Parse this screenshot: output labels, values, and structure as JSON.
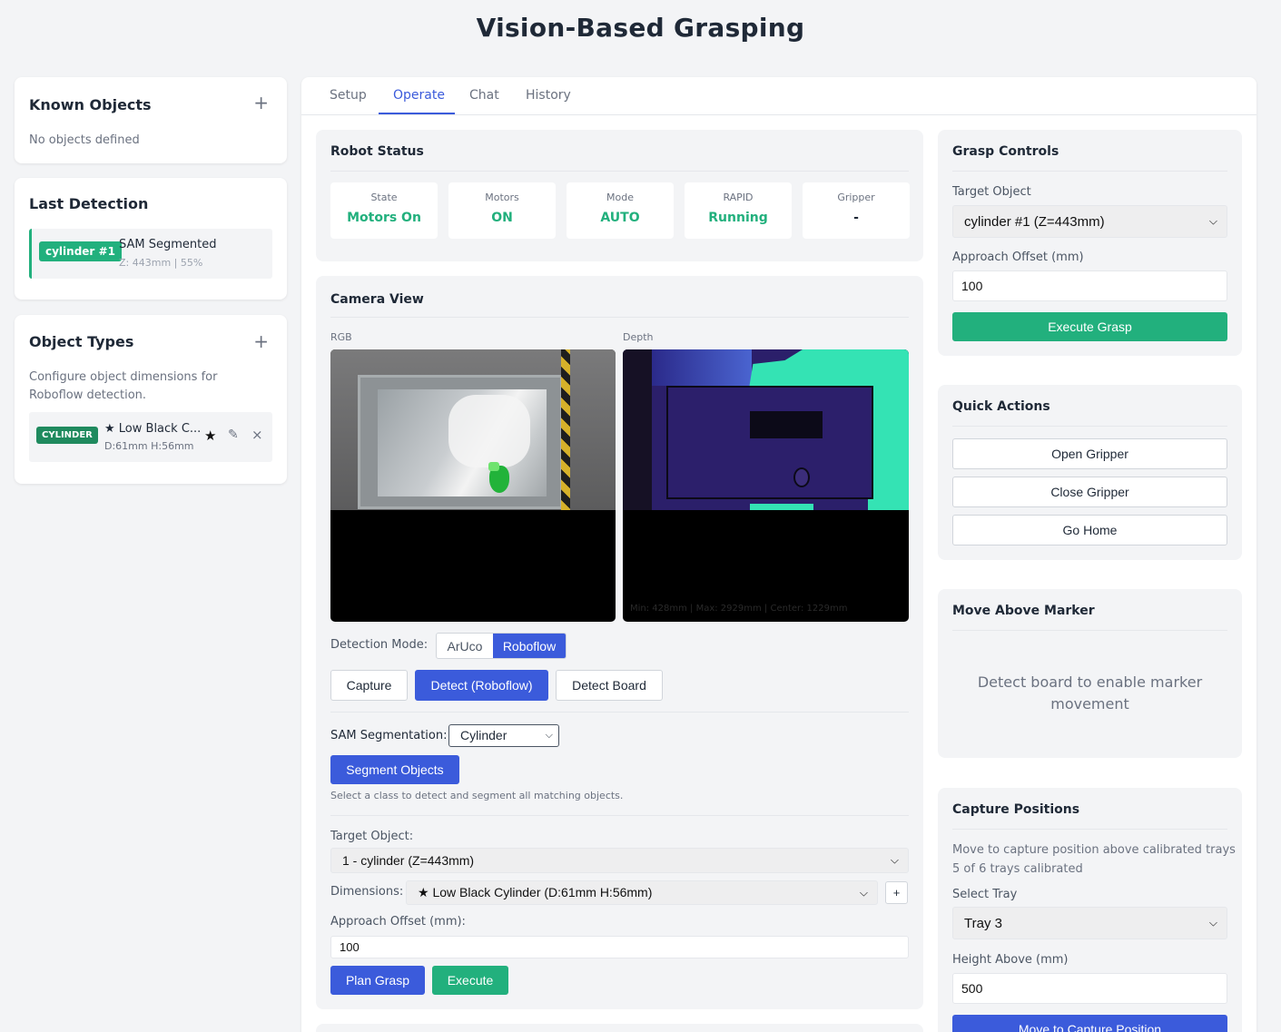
{
  "page_title": "Vision-Based Grasping",
  "known_objects": {
    "title": "Known Objects",
    "add": "+",
    "empty_text": "No objects defined"
  },
  "last_detection": {
    "title": "Last Detection",
    "badge": "cylinder #1",
    "method": "SAM Segmented",
    "meta": "Z: 443mm | 55%"
  },
  "object_types": {
    "title": "Object Types",
    "add": "+",
    "description": "Configure object dimensions for Roboflow detection.",
    "items": [
      {
        "tag": "CYLINDER",
        "name": "★ Low Black C...",
        "dims": "D:61mm H:56mm",
        "star": "★",
        "edit": "✎",
        "remove": "×"
      }
    ]
  },
  "tabs": [
    {
      "label": "Setup"
    },
    {
      "label": "Operate"
    },
    {
      "label": "Chat"
    },
    {
      "label": "History"
    }
  ],
  "active_tab": "Operate",
  "robot_status": {
    "title": "Robot Status",
    "items": [
      {
        "label": "State",
        "value": "Motors On"
      },
      {
        "label": "Motors",
        "value": "ON"
      },
      {
        "label": "Mode",
        "value": "AUTO"
      },
      {
        "label": "RAPID",
        "value": "Running"
      },
      {
        "label": "Gripper",
        "value": "-"
      }
    ],
    "ok_color": "#22b07d"
  },
  "camera_view": {
    "title": "Camera View",
    "rgb_label": "RGB",
    "depth_label": "Depth",
    "depth_info": "Min: 428mm | Max: 2929mm | Center: 1229mm",
    "detection_mode_label": "Detection Mode:",
    "modes": [
      "ArUco",
      "Roboflow"
    ],
    "active_mode": "Roboflow",
    "capture": "Capture",
    "detect": "Detect (Roboflow)",
    "detect_board": "Detect Board",
    "sam_label": "SAM Segmentation:",
    "sam_value": "Cylinder",
    "segment_button": "Segment Objects",
    "sam_hint": "Select a class to detect and segment all matching objects.",
    "target_label": "Target Object:",
    "target_value": "1 - cylinder (Z=443mm)",
    "dimensions_label": "Dimensions:",
    "dimensions_value": "★ Low Black Cylinder (D:61mm H:56mm)",
    "dimensions_add": "+",
    "offset_label": "Approach Offset (mm):",
    "offset_value": "100",
    "plan": "Plan Grasp",
    "execute": "Execute"
  },
  "grasp_controls": {
    "title": "Grasp Controls",
    "target_label": "Target Object",
    "target_value": "cylinder #1 (Z=443mm)",
    "offset_label": "Approach Offset (mm)",
    "offset_value": "100",
    "execute": "Execute Grasp"
  },
  "quick_actions": {
    "title": "Quick Actions",
    "open": "Open Gripper",
    "close": "Close Gripper",
    "home": "Go Home"
  },
  "move_marker": {
    "title": "Move Above Marker",
    "message": "Detect board to enable marker movement"
  },
  "capture_positions": {
    "title": "Capture Positions",
    "description": "Move to capture position above calibrated trays",
    "calibrated": "5 of 6 trays calibrated",
    "tray_label": "Select Tray",
    "tray_value": "Tray 3",
    "height_label": "Height Above (mm)",
    "height_value": "500",
    "move_button": "Move to Capture Position"
  },
  "colors": {
    "primary": "#3b5bdb",
    "success": "#22b07d",
    "depth_bg": "#2a1f6b",
    "depth_far": "#34e3b4"
  }
}
